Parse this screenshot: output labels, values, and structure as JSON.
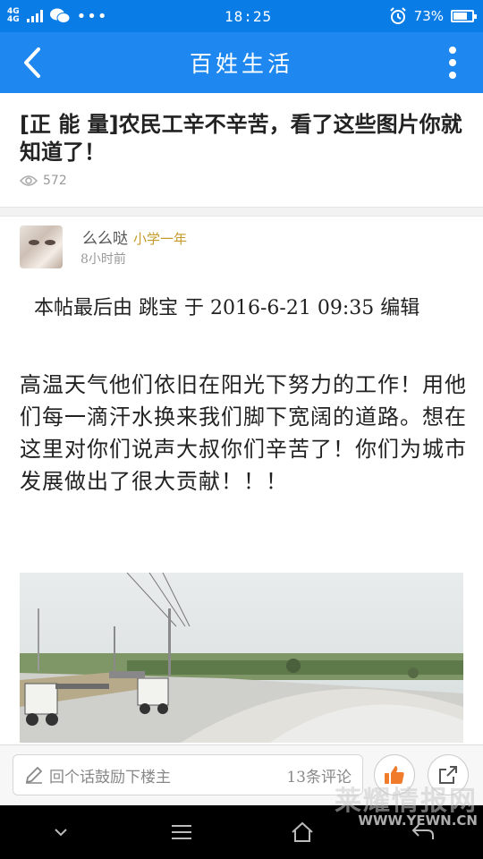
{
  "status_bar": {
    "network_1": "4G",
    "network_2": "4G",
    "time": "18:25",
    "battery": "73%",
    "battery_level": 0.73
  },
  "app_bar": {
    "title": "百姓生活"
  },
  "post": {
    "title": "[正 能 量]农民工辛不辛苦，看了这些图片你就知道了！",
    "views": "572"
  },
  "author": {
    "name": "么么哒",
    "level": "小学一年",
    "time": "8小时前"
  },
  "content": {
    "edit_note": "本帖最后由 跳宝 于 2016-6-21 09:35 编辑",
    "body": "高温天气他们依旧在阳光下努力的工作！用他们每一滴汗水换来我们脚下宽阔的道路。想在这里对你们说声大叔你们辛苦了！你们为城市发展做出了很大贡献！！！"
  },
  "comment_bar": {
    "placeholder": "回个话鼓励下楼主",
    "count": "13条评论"
  },
  "watermark": {
    "main": "莱耀情报网",
    "url": "WWW.YEWN.CN"
  },
  "icons": {
    "back": "back-arrow-icon",
    "more": "more-vertical-icon",
    "eye": "eye-icon",
    "pencil": "pencil-icon",
    "like": "thumbs-up-icon",
    "share": "share-icon"
  },
  "colors": {
    "status_bar": "#0a7ce6",
    "app_bar": "#1e88f0",
    "level": "#c59a2a",
    "like": "#f07b2a"
  }
}
